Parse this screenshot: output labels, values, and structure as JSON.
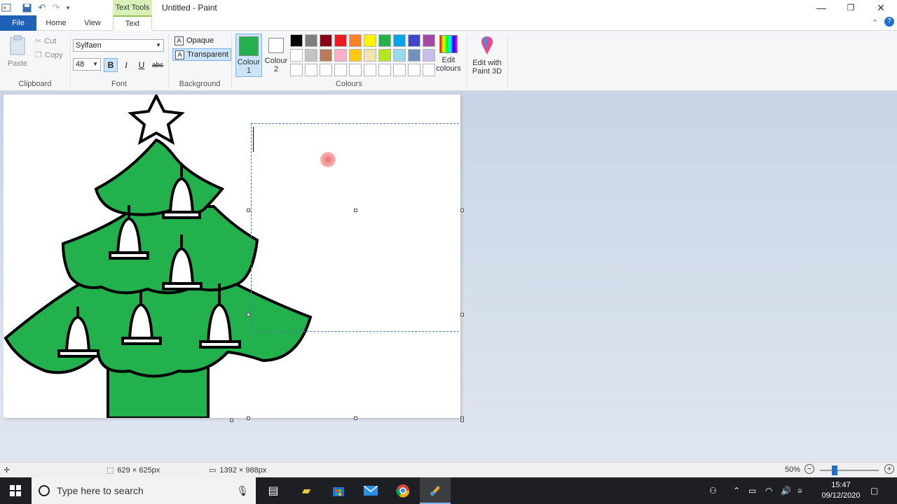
{
  "titlebar": {
    "contextual_tab": "Text Tools",
    "title": "Untitled - Paint",
    "minimize": "—",
    "restore": "❐",
    "close": "✕"
  },
  "tabs": {
    "file": "File",
    "home": "Home",
    "view": "View",
    "text": "Text"
  },
  "ribbon": {
    "clipboard": {
      "paste": "Paste",
      "cut": "Cut",
      "copy": "Copy",
      "label": "Clipboard"
    },
    "font": {
      "family": "Sylfaen",
      "size": "48",
      "bold": "B",
      "italic": "I",
      "underline": "U",
      "strikethrough": "abc",
      "label": "Font"
    },
    "background": {
      "opaque": "Opaque",
      "transparent": "Transparent",
      "label": "Background"
    },
    "colours": {
      "colour1_line1": "Colour",
      "colour1_line2": "1",
      "colour2_line1": "Colour",
      "colour2_line2": "2",
      "colour1": "#22b14c",
      "colour2": "#ffffff",
      "edit_line1": "Edit",
      "edit_line2": "colours",
      "paint3d_line1": "Edit with",
      "paint3d_line2": "Paint 3D",
      "label": "Colours",
      "palette": [
        "#000000",
        "#7f7f7f",
        "#880015",
        "#ed1c24",
        "#ff7f27",
        "#fff200",
        "#22b14c",
        "#00a2e8",
        "#3f48cc",
        "#a349a4",
        "#ffffff",
        "#c3c3c3",
        "#b97a57",
        "#ffaec9",
        "#ffc90e",
        "#efe4b0",
        "#b5e61d",
        "#99d9ea",
        "#7092be",
        "#c8bfe7",
        "#ffffff",
        "#ffffff",
        "#ffffff",
        "#ffffff",
        "#ffffff",
        "#ffffff",
        "#ffffff",
        "#ffffff",
        "#ffffff",
        "#ffffff"
      ]
    }
  },
  "status": {
    "selection_size": "629 × 625px",
    "image_size": "1392 × 988px",
    "zoom": "50%"
  },
  "taskbar": {
    "search_placeholder": "Type here to search",
    "time": "15:47",
    "date": "09/12/2020"
  }
}
